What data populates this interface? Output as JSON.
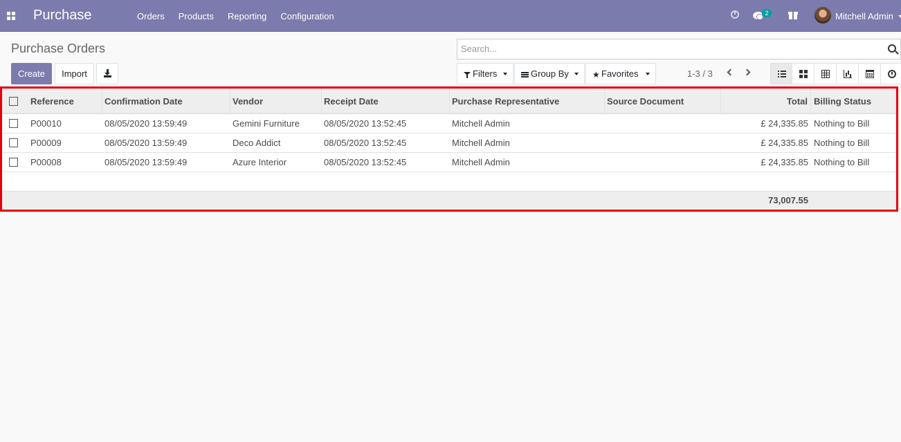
{
  "navbar": {
    "app_name": "Purchase",
    "menu": [
      "Orders",
      "Products",
      "Reporting",
      "Configuration"
    ],
    "chat_count": "2",
    "user_name": "Mitchell Admin",
    "color": "#7c7bad"
  },
  "control_panel": {
    "title": "Purchase Orders",
    "create_label": "Create",
    "import_label": "Import",
    "search_placeholder": "Search...",
    "filters_label": "Filters",
    "groupby_label": "Group By",
    "favorites_label": "Favorites",
    "pager": "1-3 / 3",
    "views": [
      "list-icon",
      "kanban-icon",
      "pivot-icon",
      "graph-icon",
      "calendar-icon",
      "activity-icon"
    ]
  },
  "table": {
    "columns": [
      "Reference",
      "Confirmation Date",
      "Vendor",
      "Receipt Date",
      "Purchase Representative",
      "Source Document",
      "Total",
      "Billing Status"
    ],
    "rows": [
      {
        "reference": "P00010",
        "confirmation_date": "08/05/2020 13:59:49",
        "vendor": "Gemini Furniture",
        "receipt_date": "08/05/2020 13:52:45",
        "representative": "Mitchell Admin",
        "source": "",
        "total": "£ 24,335.85",
        "billing_status": "Nothing to Bill"
      },
      {
        "reference": "P00009",
        "confirmation_date": "08/05/2020 13:59:49",
        "vendor": "Deco Addict",
        "receipt_date": "08/05/2020 13:52:45",
        "representative": "Mitchell Admin",
        "source": "",
        "total": "£ 24,335.85",
        "billing_status": "Nothing to Bill"
      },
      {
        "reference": "P00008",
        "confirmation_date": "08/05/2020 13:59:49",
        "vendor": "Azure Interior",
        "receipt_date": "08/05/2020 13:52:45",
        "representative": "Mitchell Admin",
        "source": "",
        "total": "£ 24,335.85",
        "billing_status": "Nothing to Bill"
      }
    ],
    "grand_total": "73,007.55"
  },
  "highlight_color": "#e8000b"
}
